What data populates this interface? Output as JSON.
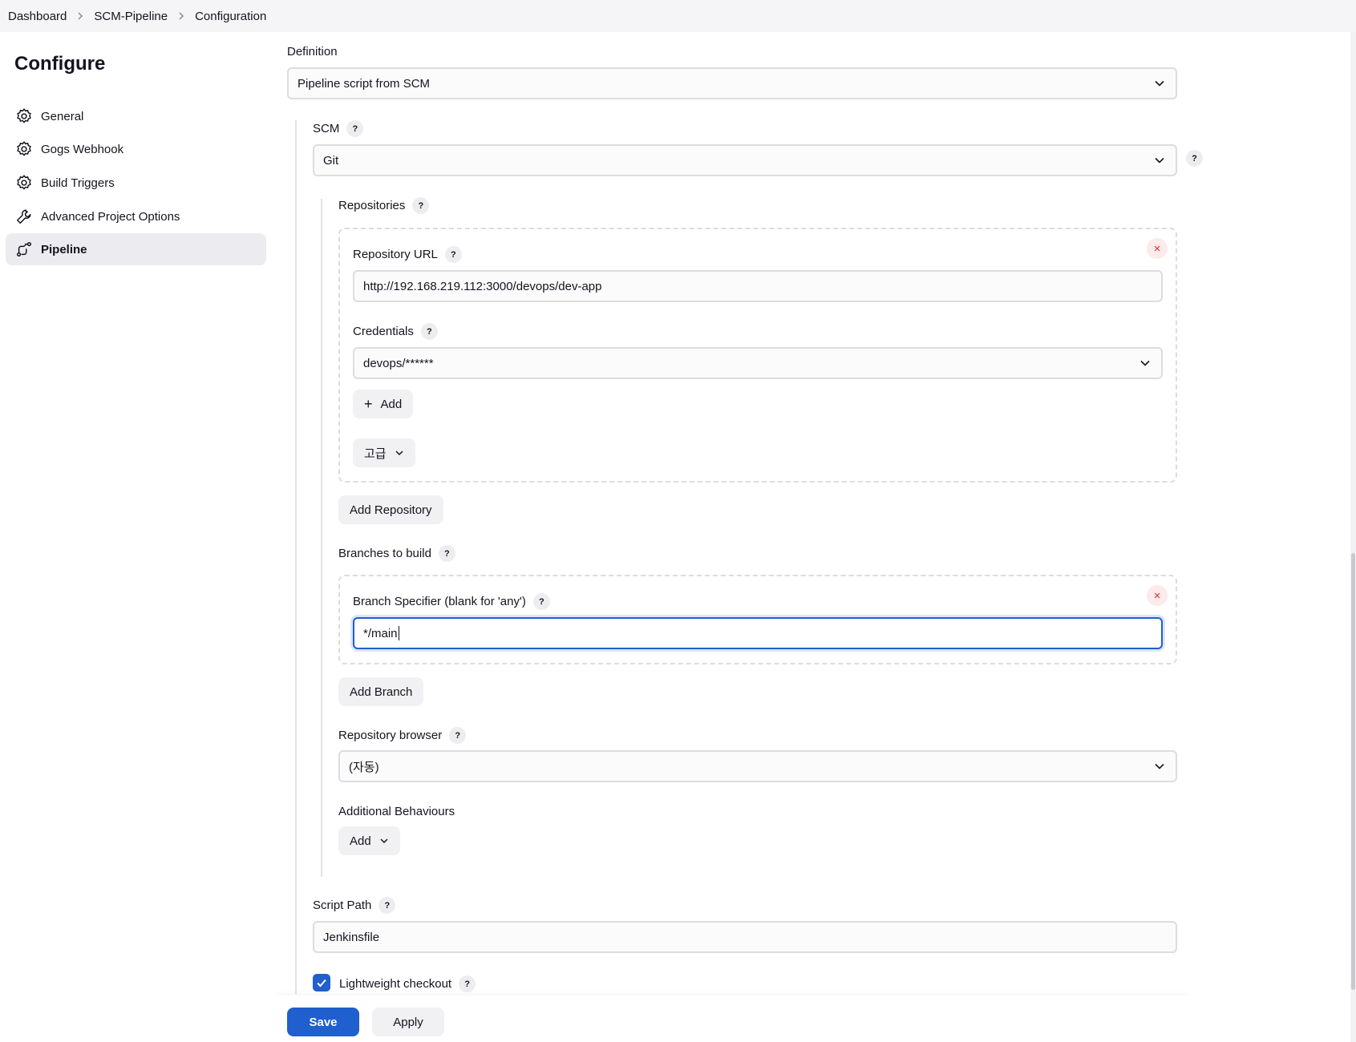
{
  "breadcrumb": {
    "items": [
      "Dashboard",
      "SCM-Pipeline",
      "Configuration"
    ]
  },
  "sidebar": {
    "title": "Configure",
    "items": [
      {
        "label": "General",
        "icon": "gear-icon"
      },
      {
        "label": "Gogs Webhook",
        "icon": "gear-icon"
      },
      {
        "label": "Build Triggers",
        "icon": "gear-icon"
      },
      {
        "label": "Advanced Project Options",
        "icon": "wrench-icon"
      },
      {
        "label": "Pipeline",
        "icon": "pipeline-icon",
        "active": true
      }
    ]
  },
  "form": {
    "definition": {
      "label": "Definition",
      "value": "Pipeline script from SCM"
    },
    "scm": {
      "label": "SCM",
      "help": "?",
      "value": "Git"
    },
    "repositories": {
      "label": "Repositories",
      "url_label": "Repository URL",
      "url_value": "http://192.168.219.112:3000/devops/dev-app",
      "credentials_label": "Credentials",
      "credentials_value": "devops/******",
      "add_label": "Add",
      "advanced_label": "고급",
      "add_repository_label": "Add Repository",
      "remove_icon": "×"
    },
    "branches": {
      "label": "Branches to build",
      "specifier_label": "Branch Specifier (blank for 'any')",
      "specifier_value": "*/main",
      "add_branch_label": "Add Branch"
    },
    "browser": {
      "label": "Repository browser",
      "value": "(자동)"
    },
    "behaviours": {
      "label": "Additional Behaviours",
      "add_label": "Add"
    },
    "script_path": {
      "label": "Script Path",
      "value": "Jenkinsfile"
    },
    "lightweight": {
      "label": "Lightweight checkout",
      "checked": true
    }
  },
  "actions": {
    "save_label": "Save",
    "apply_label": "Apply"
  },
  "colors": {
    "accent": "#1f5fce",
    "remove": "#d62d2d"
  }
}
